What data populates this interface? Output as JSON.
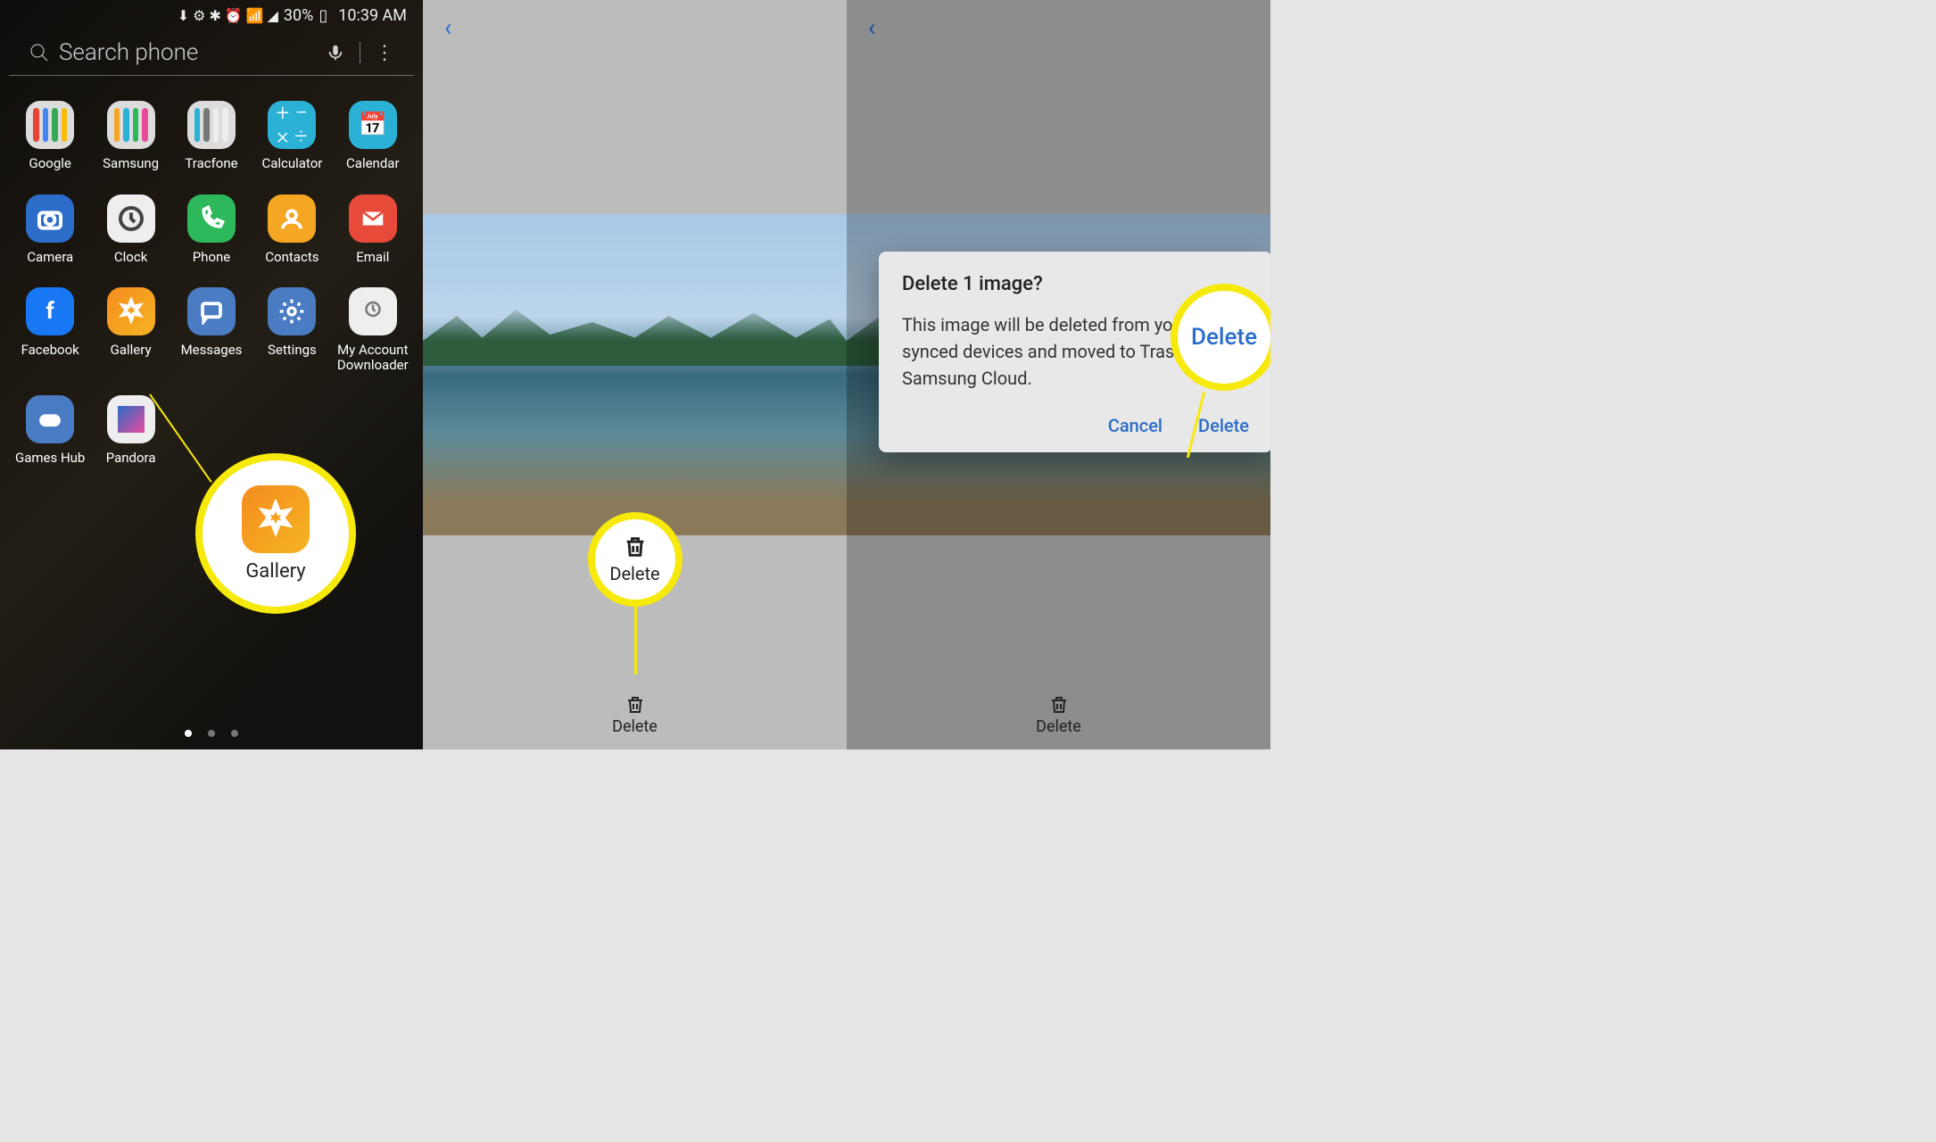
{
  "statusbar": {
    "battery_pct": "30%",
    "time": "10:39 AM"
  },
  "drawer": {
    "search_placeholder": "Search phone",
    "apps": {
      "google": "Google",
      "samsung": "Samsung",
      "tracfone": "Tracfone",
      "calculator": "Calculator",
      "calendar": "Calendar",
      "camera": "Camera",
      "clock": "Clock",
      "phone": "Phone",
      "contacts": "Contacts",
      "email": "Email",
      "facebook": "Facebook",
      "gallery": "Gallery",
      "messages": "Messages",
      "settings": "Settings",
      "myaccount": "My Account Downloader",
      "gameshub": "Games Hub",
      "pandora": "Pandora"
    },
    "highlight_label": "Gallery"
  },
  "viewer": {
    "delete_label": "Delete",
    "highlight_label": "Delete"
  },
  "dialog": {
    "title": "Delete 1 image?",
    "body": "This image will be deleted from your synced devices and moved to Trash in Samsung Cloud.",
    "cancel": "Cancel",
    "delete": "Delete",
    "highlight_label": "Delete"
  },
  "colors": {
    "highlight": "#f6e90b",
    "link": "#2b6dc9"
  }
}
